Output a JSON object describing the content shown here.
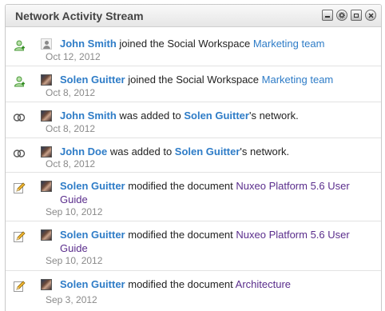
{
  "widget": {
    "title": "Network Activity Stream",
    "tools": [
      "minimize-icon",
      "settings-icon",
      "maximize-icon",
      "close-icon"
    ]
  },
  "colors": {
    "actor_link": "#2e7cc7",
    "document_link": "#5a2d8c",
    "date": "#8a8a8a"
  },
  "activities": [
    {
      "type_icon": "user-add-icon",
      "avatar": "default",
      "actor": "John Smith",
      "verb": " joined the Social Workspace ",
      "object": "Marketing team",
      "suffix": "",
      "date": "Oct 12, 2012"
    },
    {
      "type_icon": "user-add-icon",
      "avatar": "photo",
      "actor": "Solen Guitter",
      "verb": " joined the Social Workspace ",
      "object": "Marketing team",
      "suffix": "",
      "date": "Oct 8, 2012"
    },
    {
      "type_icon": "network-icon",
      "avatar": "photo",
      "actor": "John Smith",
      "verb": " was added to ",
      "object": "Solen Guitter",
      "suffix": "'s network.",
      "date": "Oct 8, 2012"
    },
    {
      "type_icon": "network-icon",
      "avatar": "photo",
      "actor": "John Doe",
      "verb": " was added to ",
      "object": "Solen Guitter",
      "suffix": "'s network.",
      "date": "Oct 8, 2012"
    },
    {
      "type_icon": "edit-pencil-icon",
      "avatar": "photo",
      "actor": "Solen Guitter",
      "verb": " modified the document ",
      "object": "Nuxeo Platform 5.6 User Guide",
      "suffix": "",
      "date": "Sep 10, 2012"
    },
    {
      "type_icon": "edit-pencil-icon",
      "avatar": "photo",
      "actor": "Solen Guitter",
      "verb": " modified the document ",
      "object": "Nuxeo Platform 5.6 User Guide",
      "suffix": "",
      "date": "Sep 10, 2012"
    },
    {
      "type_icon": "edit-pencil-icon",
      "avatar": "photo",
      "actor": "Solen Guitter",
      "verb": " modified the document ",
      "object": "Architecture",
      "suffix": "",
      "date": "Sep 3, 2012"
    }
  ]
}
